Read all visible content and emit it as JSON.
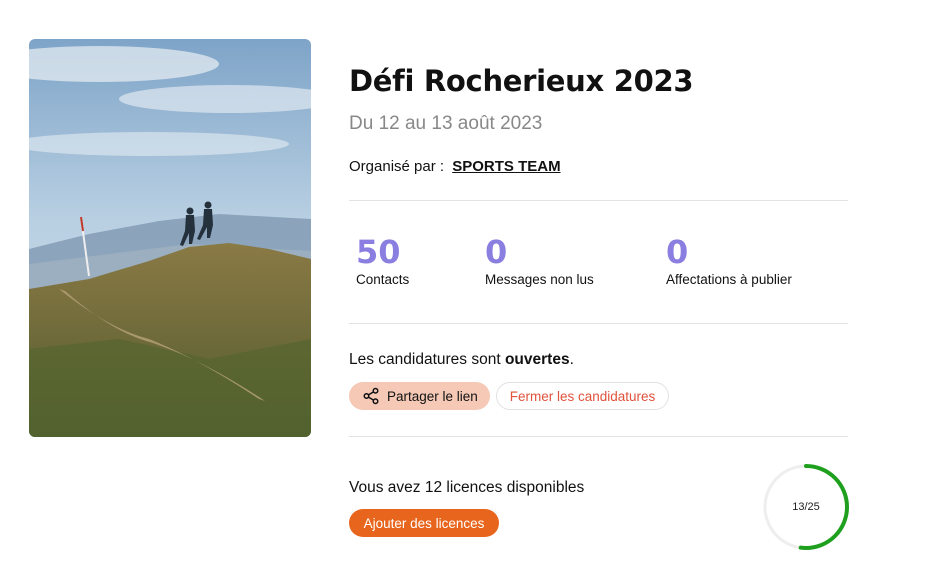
{
  "event": {
    "title": "Défi Rocherieux 2023",
    "dates": "Du 12 au 13 août 2023",
    "organizer_prefix": "Organisé par :",
    "organizer_name": "SPORTS TEAM"
  },
  "stats": [
    {
      "value": "50",
      "label": "Contacts"
    },
    {
      "value": "0",
      "label": "Messages non lus"
    },
    {
      "value": "0",
      "label": "Affectations à publier"
    }
  ],
  "applications": {
    "status_prefix": "Les candidatures sont",
    "status_value": "ouvertes",
    "status_suffix": ".",
    "share_label": "Partager le lien",
    "close_label": "Fermer les candidatures"
  },
  "licences": {
    "text_prefix": "Vous avez",
    "available": "12",
    "text_suffix": "licences disponibles",
    "add_label": "Ajouter des licences",
    "used": 13,
    "total": 25,
    "gauge_text": "13/25"
  },
  "colors": {
    "accent_purple": "#8a7fe0",
    "share_bg": "#f5c9b6",
    "close_text": "#e0523b",
    "add_bg": "#e8651d",
    "gauge_green": "#1ea01e"
  },
  "icons": {
    "share": "share-icon"
  }
}
